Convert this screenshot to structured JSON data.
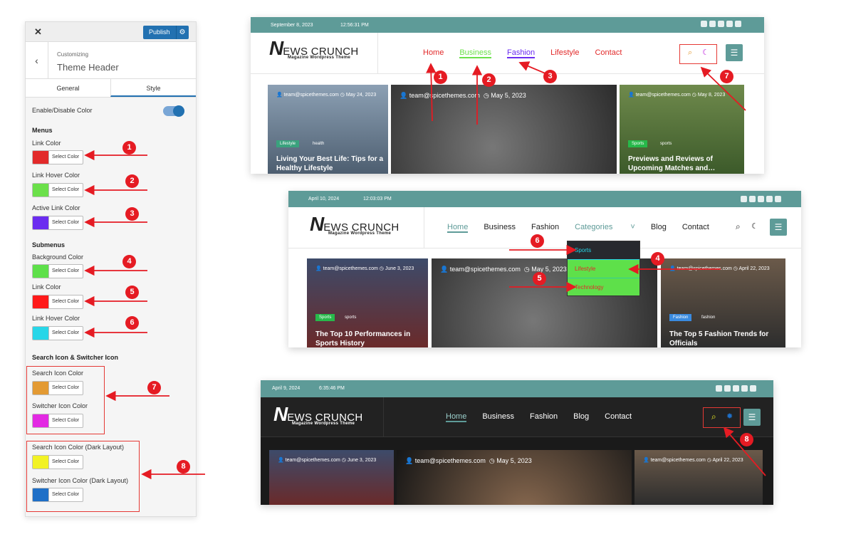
{
  "customizer": {
    "close": "✕",
    "publish": "Publish",
    "back": "‹",
    "customizing": "Customizing",
    "title": "Theme Header",
    "tabs": [
      "General",
      "Style"
    ],
    "enable_label": "Enable/Disable Color",
    "sections": {
      "menus": "Menus",
      "submenus": "Submenus",
      "icons": "Search Icon & Switcher Icon"
    },
    "select_label": "Select Color",
    "fields": [
      {
        "label": "Link Color",
        "color": "#e22a2a",
        "marker": "1"
      },
      {
        "label": "Link Hover Color",
        "color": "#6be04a",
        "marker": "2"
      },
      {
        "label": "Active Link Color",
        "color": "#6b2cf0",
        "marker": "3"
      },
      {
        "label": "Background Color",
        "color": "#5ee04a",
        "marker": "4"
      },
      {
        "label": "Link Color",
        "color": "#ff1a1a",
        "marker": "5"
      },
      {
        "label": "Link Hover Color",
        "color": "#27d6e8",
        "marker": "6"
      },
      {
        "label": "Search Icon Color",
        "color": "#e39a33"
      },
      {
        "label": "Switcher Icon Color",
        "color": "#e329e3"
      },
      {
        "label": "Search Icon Color (Dark Layout)",
        "color": "#f2f224"
      },
      {
        "label": "Switcher Icon Color (Dark Layout)",
        "color": "#1e6fc7"
      }
    ],
    "group_markers": [
      "7",
      "8"
    ]
  },
  "shot1": {
    "date": "September 8, 2023",
    "time": "12:56:31 PM",
    "logo_n": "N",
    "logo_rest": "EWS CRUNCH",
    "logo_sub": "Magazine Wordpress Theme",
    "nav": [
      "Home",
      "Business",
      "Fashion",
      "Lifestyle",
      "Contact"
    ],
    "nav_colors": [
      "#e22a2a",
      "#6be04a",
      "#6b2cf0",
      "#e22a2a",
      "#e22a2a"
    ],
    "search_color": "#e39a33",
    "moon_color": "#c02be0",
    "cards": [
      {
        "meta": "team@spicethemes.com",
        "date": "May 24, 2023",
        "tag": "Lifestyle",
        "tag2": "health",
        "title": "Living Your Best Life: Tips for a Healthy Lifestyle"
      },
      {
        "meta": "team@spicethemes.com",
        "date": "May 5, 2023"
      },
      {
        "meta": "team@spicethemes.com",
        "date": "May 8, 2023",
        "tag": "Sports",
        "tag2": "sports",
        "title": "Previews and Reviews of Upcoming Matches and…"
      }
    ],
    "markers": [
      "1",
      "2",
      "3",
      "7"
    ]
  },
  "shot2": {
    "date": "April 10, 2024",
    "time": "12:03:03 PM",
    "logo_n": "N",
    "logo_rest": "EWS CRUNCH",
    "logo_sub": "Magazine Wordpress Theme",
    "nav": [
      "Home",
      "Business",
      "Fashion",
      "Categories",
      "Blog",
      "Contact"
    ],
    "dropdown": [
      "Sports",
      "Lifestyle",
      "Technology"
    ],
    "cards": [
      {
        "meta": "team@spicethemes.com",
        "date": "June 3, 2023",
        "tag": "Sports",
        "tag2": "sports",
        "title": "The Top 10 Performances in Sports History"
      },
      {
        "meta": "team@spicethemes.com",
        "date": "May 5, 2023"
      },
      {
        "meta": "team@spicethemes.com",
        "date": "April 22, 2023",
        "tag": "Fashion",
        "tag2": "fashion",
        "title": "The Top 5 Fashion Trends for Officials"
      }
    ],
    "markers": [
      "6",
      "4",
      "5"
    ]
  },
  "shot3": {
    "date": "April 9, 2024",
    "time": "6:35:46 PM",
    "logo_n": "N",
    "logo_rest": "EWS CRUNCH",
    "logo_sub": "Magazine Wordpress Theme",
    "nav": [
      "Home",
      "Business",
      "Fashion",
      "Blog",
      "Contact"
    ],
    "cards": [
      {
        "meta": "team@spicethemes.com",
        "date": "June 3, 2023"
      },
      {
        "meta": "team@spicethemes.com",
        "date": "May 5, 2023"
      },
      {
        "meta": "team@spicethemes.com",
        "date": "April 22, 2023"
      }
    ],
    "markers": [
      "8"
    ]
  }
}
